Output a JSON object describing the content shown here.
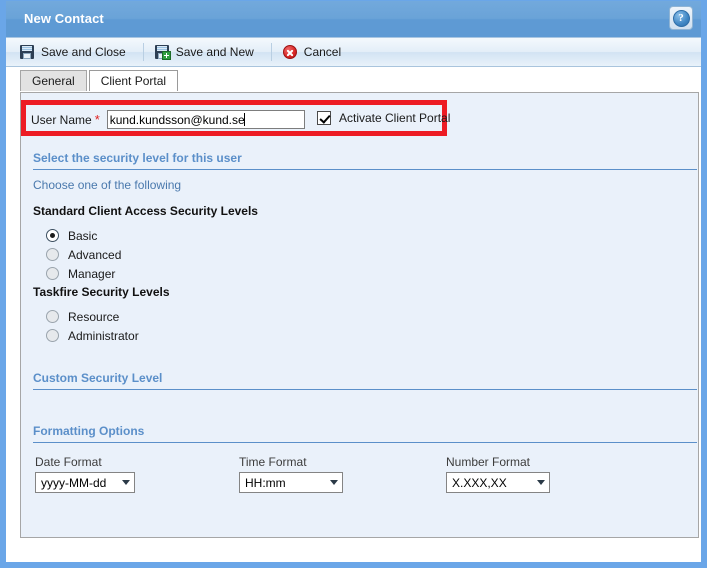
{
  "window": {
    "title": "New Contact",
    "help_icon": "help-question-icon",
    "help_glyph": "?"
  },
  "toolbar": {
    "buttons": [
      {
        "label": "Save and Close",
        "icon": "floppy-disk-icon"
      },
      {
        "label": "Save and New",
        "icon": "floppy-disk-plus-icon"
      },
      {
        "label": "Cancel",
        "icon": "red-x-circle-icon"
      }
    ]
  },
  "tabs": [
    {
      "label": "General",
      "active": false
    },
    {
      "label": "Client Portal",
      "active": true
    }
  ],
  "user_name": {
    "label": "User Name",
    "required_marker": "*",
    "value": "kund.kundsson@kund.se",
    "activate_checkbox_label": "Activate Client Portal",
    "activate_checked": true,
    "highlight_color": "#ed1c24"
  },
  "security": {
    "section_title": "Select the security level for this user",
    "instruction": "Choose one of the following",
    "groups": [
      {
        "title": "Standard Client Access Security Levels",
        "options": [
          {
            "label": "Basic",
            "selected": true
          },
          {
            "label": "Advanced",
            "selected": false
          },
          {
            "label": "Manager",
            "selected": false
          }
        ]
      },
      {
        "title": "Taskfire Security Levels",
        "options": [
          {
            "label": "Resource",
            "selected": false
          },
          {
            "label": "Administrator",
            "selected": false
          }
        ]
      }
    ]
  },
  "custom_security": {
    "section_title": "Custom Security Level"
  },
  "formatting": {
    "section_title": "Formatting Options",
    "fields": [
      {
        "label": "Date Format",
        "value": "yyyy-MM-dd"
      },
      {
        "label": "Time Format",
        "value": "HH:mm"
      },
      {
        "label": "Number Format",
        "value": "X.XXX,XX"
      }
    ]
  },
  "colors": {
    "title_bar": "#6aa3d8",
    "section_heading": "#5b8fc9",
    "panel_background": "#eaf1fa",
    "highlight": "#ed1c24"
  }
}
